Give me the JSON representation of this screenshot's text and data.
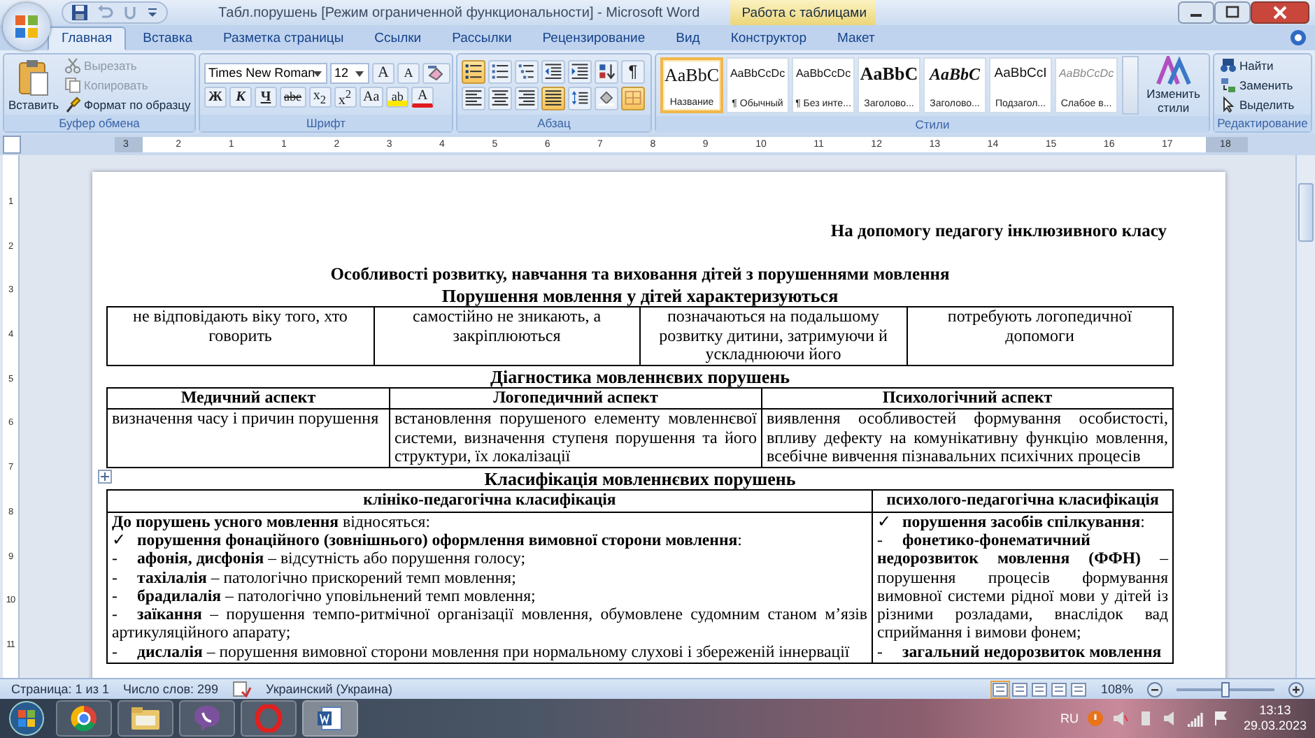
{
  "window": {
    "title": "Табл.порушень [Режим ограниченной функциональности] - Microsoft Word",
    "context": "Работа с таблицами"
  },
  "tabs": [
    {
      "label": "Главная",
      "selected": true
    },
    {
      "label": "Вставка",
      "selected": false
    },
    {
      "label": "Разметка страницы",
      "selected": false
    },
    {
      "label": "Ссылки",
      "selected": false
    },
    {
      "label": "Рассылки",
      "selected": false
    },
    {
      "label": "Рецензирование",
      "selected": false
    },
    {
      "label": "Вид",
      "selected": false
    },
    {
      "label": "Конструктор",
      "selected": false
    },
    {
      "label": "Макет",
      "selected": false
    }
  ],
  "clipboard": {
    "paste": "Вставить",
    "group": "Буфер обмена",
    "items": [
      {
        "kind": "cut",
        "label": "Вырезать",
        "disabled": true
      },
      {
        "kind": "copy",
        "label": "Копировать",
        "disabled": true
      },
      {
        "kind": "painter",
        "label": "Формат по образцу",
        "disabled": false
      }
    ]
  },
  "font": {
    "name": "Times New Roman",
    "size": "12",
    "group": "Шрифт",
    "row1": [
      {
        "kind": "grow",
        "label": "A"
      },
      {
        "kind": "shrink",
        "label": "A"
      },
      {
        "kind": "clear"
      }
    ],
    "row2": [
      {
        "kind": "bold",
        "label": "Ж"
      },
      {
        "kind": "italic",
        "label": "К"
      },
      {
        "kind": "underline",
        "label": "Ч"
      },
      {
        "kind": "strike",
        "label": "abe"
      },
      {
        "kind": "sub",
        "label": "x$_{2}$"
      },
      {
        "kind": "sup",
        "label": "x$^{2}$"
      },
      {
        "kind": "case",
        "label": "Aa"
      },
      {
        "kind": "highlight",
        "label": "ab"
      },
      {
        "kind": "color",
        "label": "A"
      }
    ]
  },
  "paragraph": {
    "group": "Абзац",
    "row1": [
      {
        "kind": "bullets",
        "selected": true
      },
      {
        "kind": "numbering",
        "selected": false
      },
      {
        "kind": "multilevel",
        "selected": false
      },
      {
        "kind": "outdent",
        "selected": false
      },
      {
        "kind": "indent",
        "selected": false
      },
      {
        "kind": "sort",
        "selected": false
      },
      {
        "kind": "marks",
        "label": "¶",
        "selected": false
      }
    ],
    "row2": [
      {
        "kind": "left",
        "selected": false
      },
      {
        "kind": "center",
        "selected": false
      },
      {
        "kind": "right",
        "selected": false
      },
      {
        "kind": "justify",
        "selected": true
      },
      {
        "kind": "spacing",
        "selected": false
      },
      {
        "kind": "shading",
        "selected": false
      },
      {
        "kind": "borders",
        "selected": true
      }
    ]
  },
  "styles": {
    "group": "Стили",
    "change": "Изменить стили",
    "items": [
      {
        "kind": "title",
        "sample": "AaBbC",
        "label": "Название",
        "selected": true
      },
      {
        "kind": "normal",
        "sample": "AaBbCcDc",
        "label": "¶ Обычный",
        "selected": false
      },
      {
        "kind": "normal",
        "sample": "AaBbCcDc",
        "label": "¶ Без инте...",
        "selected": false
      },
      {
        "kind": "heading",
        "sample": "AaBbC",
        "label": "Заголово...",
        "selected": false
      },
      {
        "kind": "heading-italic",
        "sample": "AaBbC",
        "label": "Заголово...",
        "selected": false
      },
      {
        "kind": "subtitle",
        "sample": "AaBbCcI",
        "label": "Подзагол...",
        "selected": false
      },
      {
        "kind": "subtle",
        "sample": "AaBbCcDc",
        "label": "Слабое в...",
        "selected": false
      }
    ]
  },
  "editing": {
    "group": "Редактирование",
    "items": [
      {
        "kind": "find",
        "label": "Найти"
      },
      {
        "kind": "replace",
        "label": "Заменить"
      },
      {
        "kind": "select",
        "label": "Выделить"
      }
    ]
  },
  "ruler": [
    "3",
    "2",
    "1",
    "1",
    "2",
    "3",
    "4",
    "5",
    "6",
    "7",
    "8",
    "9",
    "10",
    "11",
    "12",
    "13",
    "14",
    "15",
    "16",
    "17",
    "18"
  ],
  "vruler": [
    "1",
    "2",
    "3",
    "4",
    "5",
    "6",
    "7",
    "8",
    "9",
    "10",
    "11"
  ],
  "document": {
    "note": "На допомогу педагогу інклюзивного класу",
    "title": "Особливості розвитку, навчання та виховання дітей з порушеннями мовлення",
    "traits": {
      "heading": "Порушення мовлення у дітей характеризуються",
      "cells": [
        "не відповідають віку того, хто говорить",
        "самостійно не зникають, а закріплюються",
        "позначаються на подальшому розвитку дитини, затримуючи й ускладнюючи його",
        "потребують логопедичної допомоги"
      ]
    },
    "diagnostics": {
      "heading": "Діагностика мовленнєвих порушень",
      "columns": [
        "Медичний аспект",
        "Логопедичний аспект",
        "Психологічний аспект"
      ],
      "cells": [
        "визначення часу і причин порушення",
        "встановлення порушеного елементу мовленнєвої системи, визначення ступеня порушення та його структури, їх локалізації",
        "виявлення особливостей формування особистості, впливу дефекту на комунікативну функцію мовлення, всебічне вивчення пізнавальних психічних процесів"
      ]
    },
    "classification": {
      "heading": "Класифікація мовленнєвих порушень",
      "columns": [
        "клініко-педагогічна класифікація",
        "психолого-педагогічна класифікація"
      ],
      "cells": [
        [
          {
            "text": "**До порушень усного мовлення** відносяться:"
          },
          {
            "marker": "✓",
            "text": "**порушення фонаційного (зовнішнього) оформлення вимовної сторони мовлення**:"
          },
          {
            "marker": "-",
            "text": "**афонія, дисфонія** – відсутність або порушення голосу;"
          },
          {
            "marker": "-",
            "text": "**тахілалія** – патологічно прискорений темп мовлення;"
          },
          {
            "marker": "-",
            "text": "**брадилалія** – патологічно уповільнений темп мовлення;"
          },
          {
            "marker": "-",
            "text": "**заїкання** – порушення темпо-ритмічної організації мовлення, обумовлене судомним станом м’язів артикуляційного апарату;"
          },
          {
            "marker": "-",
            "text": "**дислалія** – порушення вимовної сторони мовлення при нормальному слухові і збереженій іннервації"
          }
        ],
        [
          {
            "marker": "✓",
            "text": "**порушення засобів спілкування**:"
          },
          {
            "marker": "-",
            "text": "**фонетико-фонематичний недорозвиток мовлення (ФФН)** – порушення процесів формування вимовної системи рідної мови у дітей із різними розладами, внаслідок вад сприймання і вимови фонем;"
          },
          {
            "marker": "-",
            "text": "**загальний недорозвиток мовлення**"
          }
        ]
      ]
    }
  },
  "status": {
    "page": "Страница: 1 из 1",
    "words": "Число слов: 299",
    "language": "Украинский (Украина)",
    "zoom": "108%",
    "level": 0.5
  },
  "taskbar": {
    "lang": "RU",
    "time": "13:13",
    "date": "29.03.2023"
  }
}
